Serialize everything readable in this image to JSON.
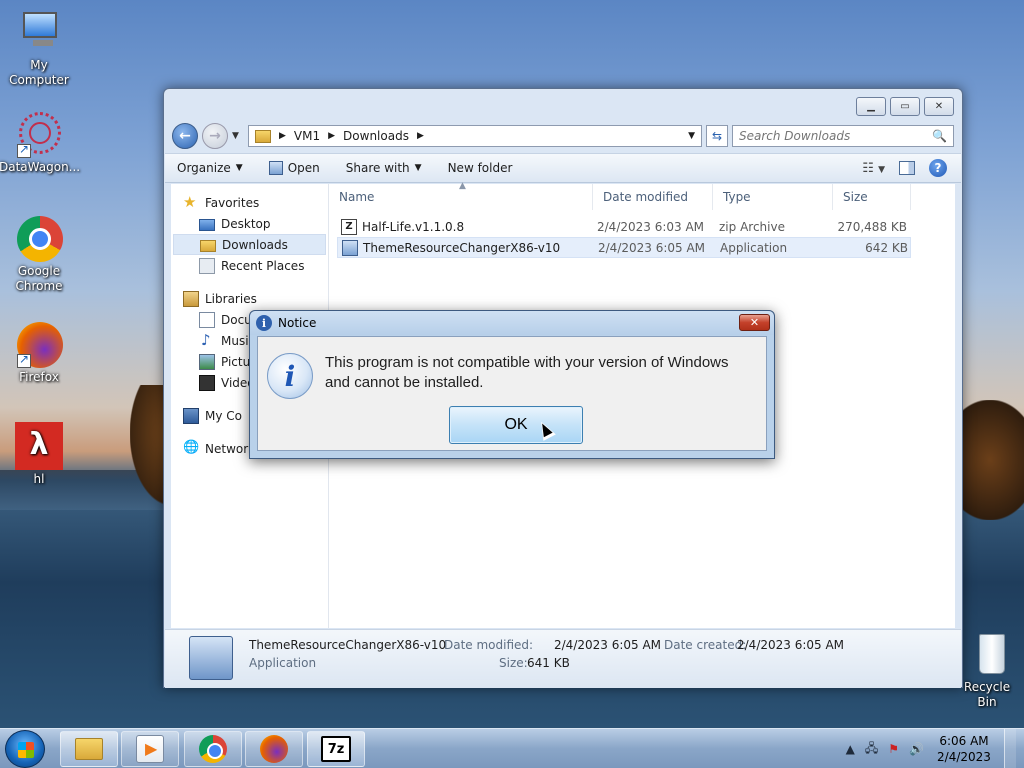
{
  "desktop": {
    "icons": [
      {
        "label": "My Computer",
        "icon": "computer-icon"
      },
      {
        "label": "DataWagon...",
        "icon": "datawagon-icon"
      },
      {
        "label": "Google Chrome",
        "icon": "chrome-icon"
      },
      {
        "label": "Firefox",
        "icon": "firefox-icon"
      },
      {
        "label": "hl",
        "icon": "half-life-icon"
      },
      {
        "label": "Recycle Bin",
        "icon": "recycle-bin-icon"
      }
    ]
  },
  "explorer": {
    "breadcrumb": [
      "VM1",
      "Downloads"
    ],
    "search_placeholder": "Search Downloads",
    "toolbar": {
      "organize": "Organize",
      "open": "Open",
      "share_with": "Share with",
      "new_folder": "New folder"
    },
    "nav": {
      "favorites": "Favorites",
      "desktop": "Desktop",
      "downloads": "Downloads",
      "recent_places": "Recent Places",
      "libraries": "Libraries",
      "documents": "Docu",
      "music": "Musi",
      "pictures": "Pictu",
      "videos": "Video",
      "computer": "My Co",
      "network": "Network"
    },
    "columns": {
      "name": "Name",
      "date": "Date modified",
      "type": "Type",
      "size": "Size"
    },
    "files": [
      {
        "name": "Half-Life.v1.1.0.8",
        "date": "2/4/2023 6:03 AM",
        "type": "zip Archive",
        "size": "270,488 KB"
      },
      {
        "name": "ThemeResourceChangerX86-v10",
        "date": "2/4/2023 6:05 AM",
        "type": "Application",
        "size": "642 KB"
      }
    ],
    "details": {
      "name": "ThemeResourceChangerX86-v10",
      "kind": "Application",
      "modified_label": "Date modified:",
      "modified_value": "2/4/2023 6:05 AM",
      "created_label": "Date created:",
      "created_value": "2/4/2023 6:05 AM",
      "size_label": "Size:",
      "size_value": "641 KB"
    }
  },
  "dialog": {
    "title": "Notice",
    "message_line1": "This program is not compatible with your version of Windows",
    "message_line2": "and cannot be installed.",
    "ok_label": "OK"
  },
  "taskbar": {
    "apps": [
      "windows-explorer",
      "media-player",
      "google-chrome",
      "firefox",
      "7-zip"
    ],
    "seven_zip_label": "7z",
    "clock_time": "6:06 AM",
    "clock_date": "2/4/2023"
  }
}
